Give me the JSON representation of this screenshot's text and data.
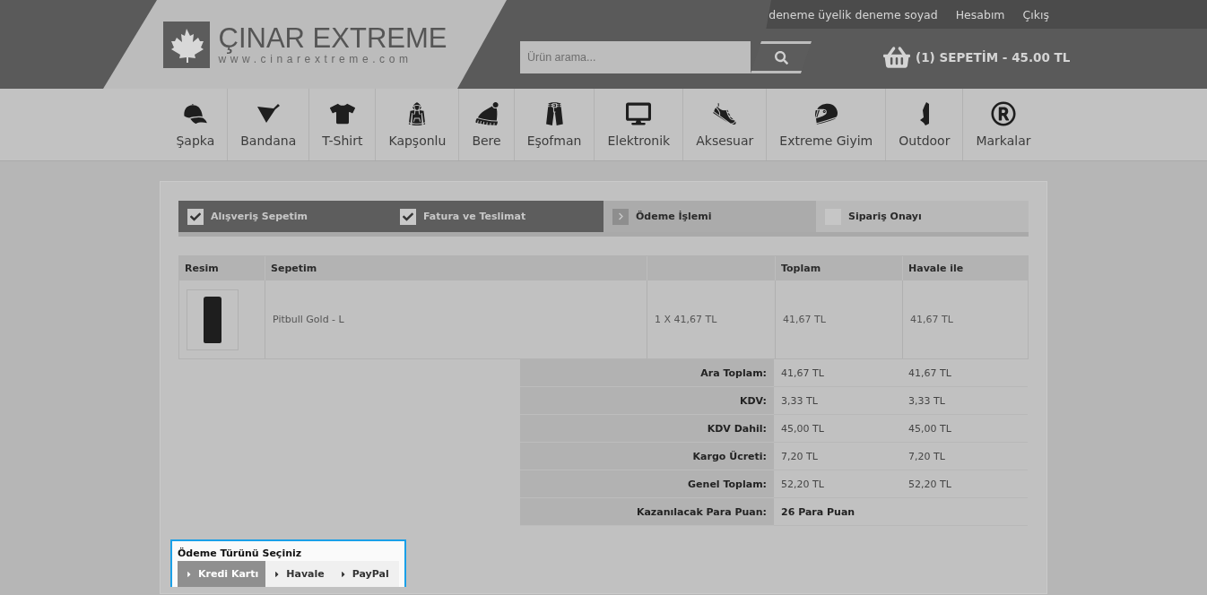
{
  "header": {
    "logo_title": "ÇINAR EXTREME",
    "logo_url": "www.cinarextreme.com",
    "user_links": [
      "deneme üyelik deneme soyad",
      "Hesabım",
      "Çıkış"
    ],
    "search": {
      "placeholder": "Ürün arama..."
    },
    "cart": "(1) SEPETİM - 45.00 TL"
  },
  "categories": [
    "Şapka",
    "Bandana",
    "T-Shirt",
    "Kapşonlu",
    "Bere",
    "Eşofman",
    "Elektronik",
    "Aksesuar",
    "Extreme Giyim",
    "Outdoor",
    "Markalar"
  ],
  "steps": [
    {
      "label": "Alışveriş Sepetim",
      "kind": "done"
    },
    {
      "label": "Fatura ve Teslimat",
      "kind": "done"
    },
    {
      "label": "Ödeme İşlemi",
      "kind": "current"
    },
    {
      "label": "Sipariş Onayı",
      "kind": "pending"
    }
  ],
  "cart_table": {
    "columns": {
      "resim": "Resim",
      "sepetim": "Sepetim",
      "toplam": "Toplam",
      "havale_ile": "Havale ile"
    },
    "rows": [
      {
        "product": "Pitbull Gold - L",
        "quantity_price": "1 X 41,67 TL",
        "toplam": "41,67 TL",
        "havale_ile": "41,67 TL"
      }
    ]
  },
  "summary": [
    {
      "label": "Ara Toplam:",
      "toplam": "41,67 TL",
      "havale_ile": "41,67 TL",
      "kind": "amount"
    },
    {
      "label": "KDV:",
      "toplam": "3,33 TL",
      "havale_ile": "3,33 TL",
      "kind": "amount"
    },
    {
      "label": "KDV Dahil:",
      "toplam": "45,00 TL",
      "havale_ile": "45,00 TL",
      "kind": "amount"
    },
    {
      "label": "Kargo Ücreti:",
      "toplam": "7,20 TL",
      "havale_ile": "7,20 TL",
      "kind": "amount"
    },
    {
      "label": "Genel Toplam:",
      "toplam": "52,20 TL",
      "havale_ile": "52,20 TL",
      "kind": "amount"
    },
    {
      "label": "Kazanılacak Para Puan:",
      "toplam": "26 Para Puan",
      "kind": "points"
    }
  ],
  "payment": {
    "title": "Ödeme Türünü Seçiniz",
    "options": [
      {
        "label": "Kredi Kartı",
        "selected": true
      },
      {
        "label": "Havale",
        "selected": false
      },
      {
        "label": "PayPal",
        "selected": false
      }
    ]
  }
}
